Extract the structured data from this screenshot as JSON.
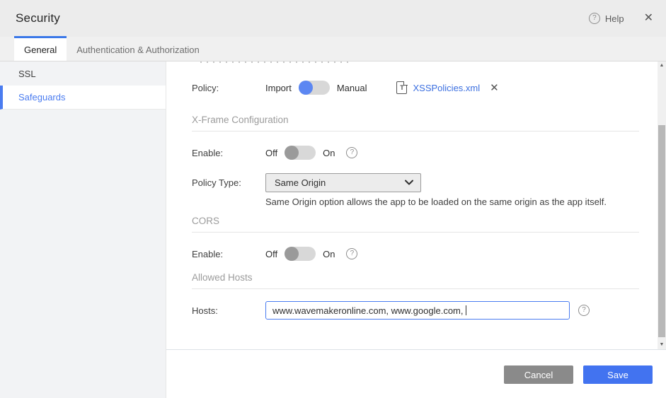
{
  "header": {
    "title": "Security",
    "help_label": "Help"
  },
  "tabs": [
    {
      "label": "General",
      "active": true
    },
    {
      "label": "Authentication & Authorization",
      "active": false
    }
  ],
  "sidebar": {
    "items": [
      {
        "label": "SSL",
        "active": false
      },
      {
        "label": "Safeguards",
        "active": true
      }
    ]
  },
  "form": {
    "policy": {
      "label": "Policy:",
      "toggle_left": "Import",
      "toggle_right": "Manual",
      "toggle_state": "Import",
      "file_name": "XSSPolicies.xml"
    },
    "xframe": {
      "section_title": "X-Frame Configuration",
      "enable": {
        "label": "Enable:",
        "off": "Off",
        "on": "On",
        "state": "Off"
      },
      "policy_type": {
        "label": "Policy Type:",
        "value": "Same Origin"
      },
      "helper": "Same Origin option allows the app to be loaded on the same origin as the app itself."
    },
    "cors": {
      "section_title": "CORS",
      "enable": {
        "label": "Enable:",
        "off": "Off",
        "on": "On",
        "state": "Off"
      }
    },
    "allowed_hosts": {
      "section_title": "Allowed Hosts",
      "hosts": {
        "label": "Hosts:",
        "value": "www.wavemakeronline.com, www.google.com, "
      }
    }
  },
  "footer": {
    "cancel_label": "Cancel",
    "save_label": "Save"
  },
  "icons": {
    "help": "?",
    "close": "✕",
    "remove": "✕",
    "file_letter": "T",
    "scroll_up": "▲",
    "scroll_down": "▼"
  },
  "colors": {
    "accent_blue": "#4273f0",
    "link_blue": "#3b6fe0",
    "toggle_on_blue": "#5c87f2",
    "sidebar_active_blue": "#4a7cf0",
    "cancel_gray": "#8a8a8a",
    "section_title_gray": "#9b9b9b"
  }
}
